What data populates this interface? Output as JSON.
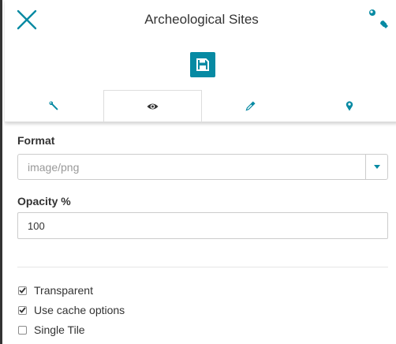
{
  "header": {
    "title": "Archeological Sites",
    "close_icon": "close-icon",
    "settings_icon": "wrench-icon",
    "save_icon": "floppy-disk-icon",
    "accent_color": "#078aa3"
  },
  "tabs": [
    {
      "icon": "wrench-icon",
      "active": false
    },
    {
      "icon": "eye-icon",
      "active": true
    },
    {
      "icon": "eyedropper-icon",
      "active": false
    },
    {
      "icon": "map-marker-icon",
      "active": false
    }
  ],
  "format": {
    "label": "Format",
    "value": "image/png"
  },
  "opacity": {
    "label": "Opacity %",
    "value": "100"
  },
  "options": [
    {
      "label": "Transparent",
      "checked": true
    },
    {
      "label": "Use cache options",
      "checked": true
    },
    {
      "label": "Single Tile",
      "checked": false
    }
  ]
}
